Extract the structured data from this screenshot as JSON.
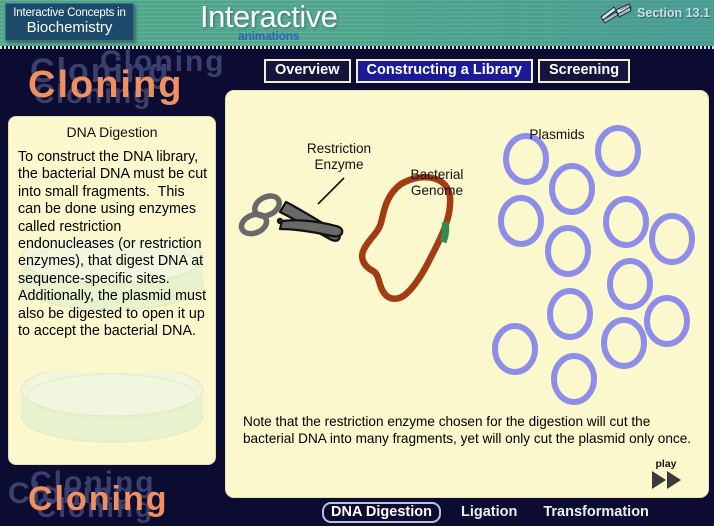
{
  "header": {
    "logo_line1": "Interactive Concepts in",
    "logo_line2": "Biochemistry",
    "brand_word": "Interactive",
    "brand_sub": "animations",
    "section_label": "Section 13.1",
    "book_icon": "open-book-icon"
  },
  "watermark": {
    "word": "Cloning"
  },
  "top_tabs": [
    {
      "label": "Overview",
      "active": false
    },
    {
      "label": "Constructing a Library",
      "active": true
    },
    {
      "label": "Screening",
      "active": false
    }
  ],
  "left_panel": {
    "title": "DNA Digestion",
    "body": "To construct the DNA library, the bacterial DNA must be cut into small fragments.  This can be done using enzymes called restriction endonucleases (or restriction enzymes), that digest DNA at sequence-specific sites.  Additionally, the plasmid must also be digested to open it up to accept the bacterial DNA."
  },
  "main_panel": {
    "labels": {
      "restriction_enzyme": "Restriction\nEnzyme",
      "bacterial_genome": "Bacterial\nGenome",
      "plasmids": "Plasmids"
    },
    "note": "Note that the restriction enzyme chosen for the digestion will cut the bacterial DNA into many fragments, yet will only cut the plasmid only once.",
    "play_label": "play",
    "play_icon": "fast-forward-play-icon",
    "plasmid_count": 13
  },
  "bottom_nav": [
    {
      "label": "DNA Digestion",
      "selected": true
    },
    {
      "label": "Ligation",
      "selected": false
    },
    {
      "label": "Transformation",
      "selected": false
    }
  ],
  "colors": {
    "background": "#0c0c33",
    "header_teal": "#52a98e",
    "panel_cream": "#fbf8cd",
    "accent_orange": "#f09060",
    "watermark_grey": "#3b3f6b",
    "tab_active_blue": "#1b1b9a",
    "plasmid_purple": "#8e8ee8",
    "genome_brown": "#a33c12",
    "genome_cut_green": "#2e8b57",
    "scissors_grey": "#6b6b6b"
  }
}
